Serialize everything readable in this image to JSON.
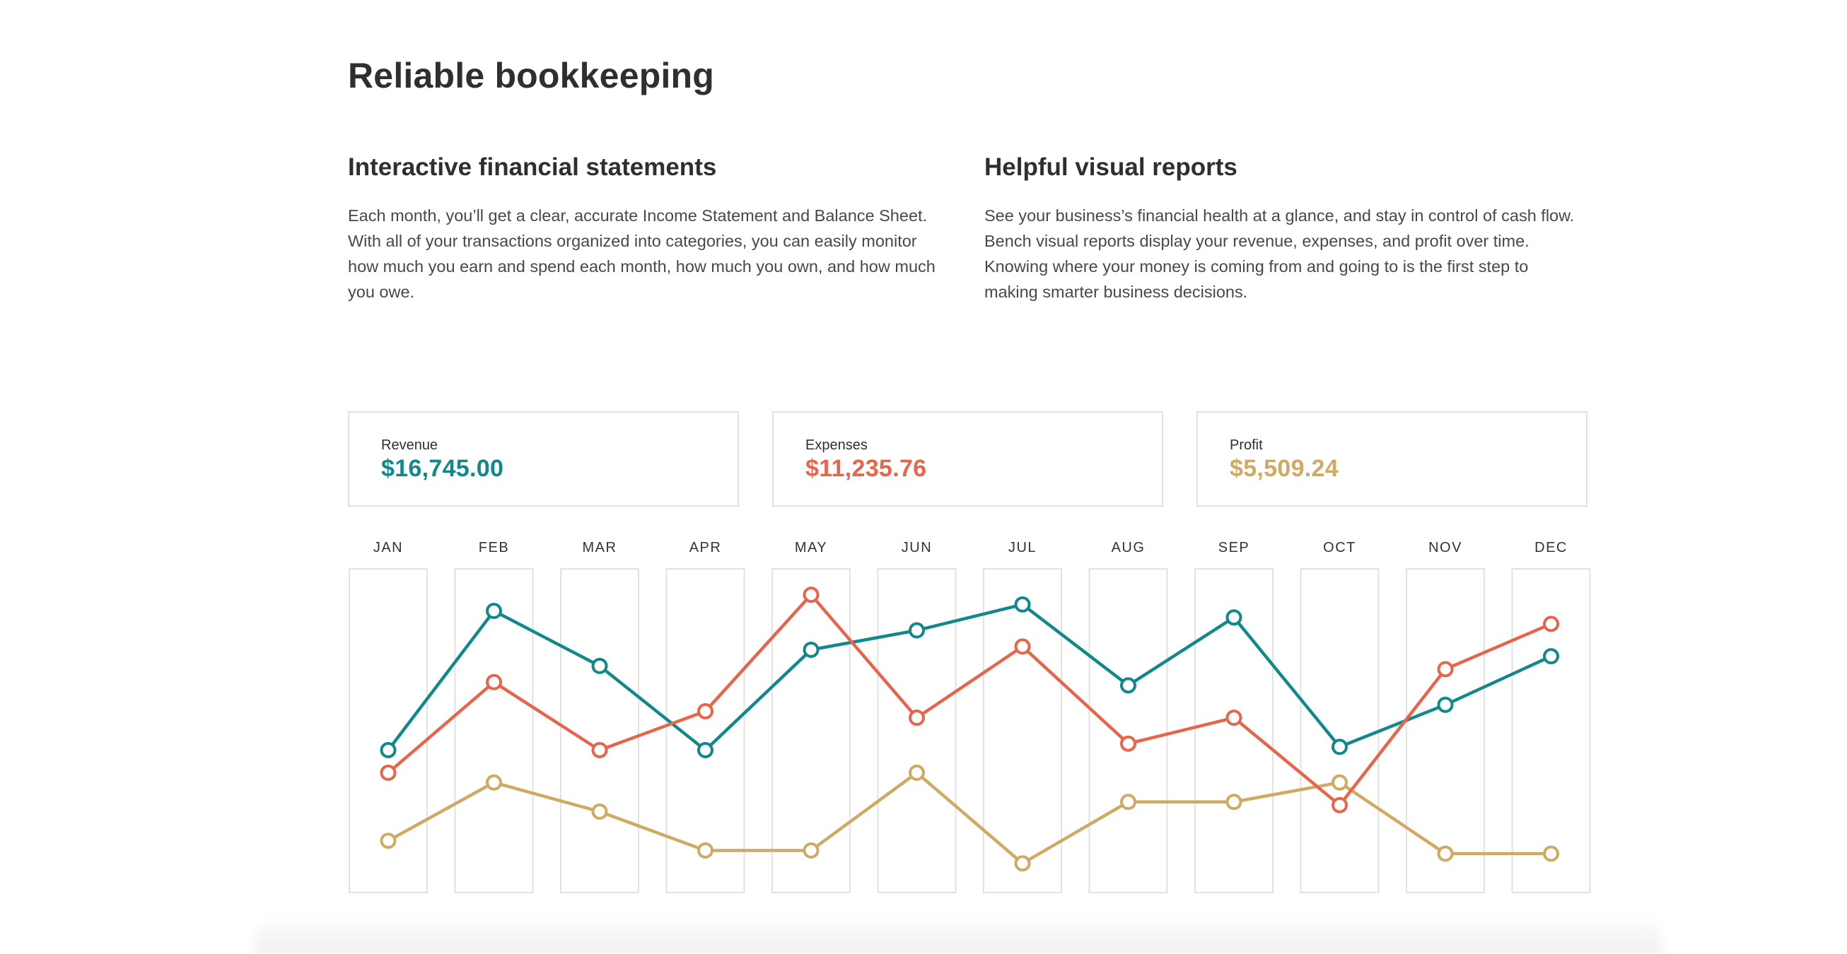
{
  "title": "Reliable bookkeeping",
  "features": [
    {
      "heading": "Interactive financial statements",
      "body": "Each month, you’ll get a clear, accurate Income Statement and Balance Sheet. With all of your transactions organized into categories, you can easily monitor how much you earn and spend each month, how much you own, and how much you owe."
    },
    {
      "heading": "Helpful visual reports",
      "body": "See your business’s financial health at a glance, and stay in control of cash flow. Bench visual reports display your revenue, expenses, and profit over time. Knowing where your money is coming from and going to is the first step to making smarter business decisions."
    }
  ],
  "stats": [
    {
      "label": "Revenue",
      "value": "$16,745.00",
      "color": "#11898a"
    },
    {
      "label": "Expenses",
      "value": "$11,235.76",
      "color": "#e8654b"
    },
    {
      "label": "Profit",
      "value": "$5,509.24",
      "color": "#d0a962"
    }
  ],
  "colors": {
    "revenue": "#11898a",
    "expenses": "#e8654b",
    "profit": "#d0a962",
    "column_border": "#e2e2e2",
    "month_label": "#333333"
  },
  "chart_data": {
    "type": "line",
    "categories": [
      "JAN",
      "FEB",
      "MAR",
      "APR",
      "MAY",
      "JUN",
      "JUL",
      "AUG",
      "SEP",
      "OCT",
      "NOV",
      "DEC"
    ],
    "series": [
      {
        "name": "Revenue",
        "color": "#11898a",
        "values": [
          0.44,
          0.87,
          0.7,
          0.44,
          0.75,
          0.81,
          0.89,
          0.64,
          0.85,
          0.45,
          0.58,
          0.73
        ]
      },
      {
        "name": "Expenses",
        "color": "#e8654b",
        "values": [
          0.37,
          0.65,
          0.44,
          0.56,
          0.92,
          0.54,
          0.76,
          0.46,
          0.54,
          0.27,
          0.69,
          0.83
        ]
      },
      {
        "name": "Profit",
        "color": "#d0a962",
        "values": [
          0.16,
          0.34,
          0.25,
          0.13,
          0.13,
          0.37,
          0.09,
          0.28,
          0.28,
          0.34,
          0.12,
          0.12
        ]
      }
    ],
    "xlabel": "",
    "ylabel": "",
    "grid": false,
    "legend": "none"
  }
}
